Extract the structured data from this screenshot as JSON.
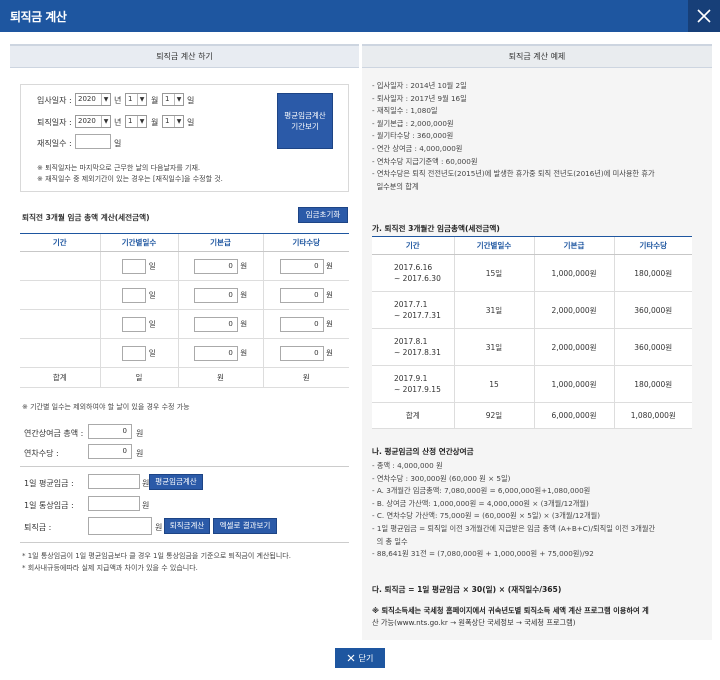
{
  "window": {
    "title": "퇴직금 계산"
  },
  "left": {
    "header": "퇴직금 계산 하기",
    "form": {
      "join_label": "입사일자 :",
      "leave_label": "퇴직일자 :",
      "workdays_label": "재직일수 :",
      "year_unit": "년",
      "month_unit": "월",
      "day_unit": "일",
      "join_year": "2020",
      "join_month": "1",
      "join_day": "1",
      "leave_year": "2020",
      "leave_month": "1",
      "leave_day": "1",
      "workdays_value": "",
      "period_button": "평균임금계산\n기간보기",
      "note1": "※ 퇴직일자는 마지막으로 근무한 날의 다음날자를 기재.",
      "note2": "※ 재직일수 중 제외기간이 있는 경우는 [재직일수]을 수정할 것."
    },
    "wage_section_title": "퇴직전 3개월 임금 총액 계산(세전금액)",
    "reset_button": "임금초기화",
    "wage_table": {
      "headers": [
        "기간",
        "기간별일수",
        "기본급",
        "기타수당"
      ],
      "rows": [
        {
          "days": "",
          "days_unit": "일",
          "basic": "0",
          "basic_unit": "원",
          "other": "0",
          "other_unit": "원"
        },
        {
          "days": "",
          "days_unit": "일",
          "basic": "0",
          "basic_unit": "원",
          "other": "0",
          "other_unit": "원"
        },
        {
          "days": "",
          "days_unit": "일",
          "basic": "0",
          "basic_unit": "원",
          "other": "0",
          "other_unit": "원"
        },
        {
          "days": "",
          "days_unit": "일",
          "basic": "0",
          "basic_unit": "원",
          "other": "0",
          "other_unit": "원"
        }
      ],
      "total_label": "합계",
      "total_days": "일",
      "total_basic": "원",
      "total_other": "원"
    },
    "days_note": "※ 기간별 일수는 제외하여야 할 날이 있을 경우 수정 가능",
    "bonus_label": "연간상여금 총액 :",
    "bonus_value": "0",
    "allowance_label": "연차수당 :",
    "allowance_value": "0",
    "won": "원",
    "avg_wage_label": "1일 평균임금 :",
    "avg_wage_button": "평균임금계산",
    "normal_wage_label": "1일 통상임금 :",
    "severance_label": "퇴직금 :",
    "severance_button": "퇴직금계산",
    "excel_button": "엑셀로 결과보기",
    "footnote1": "* 1일 통상임금이 1일 평균임금보다 클 경우 1일 통상임금을 기준으로 퇴직금이 계산됩니다.",
    "footnote2": "* 회사내규등에따라 실제 지급액과 차이가 있을 수 있습니다."
  },
  "right": {
    "header": "퇴직금 계산 예제",
    "info": [
      "- 입사일자 : 2014년 10월 2일",
      "- 퇴사일자 : 2017년 9월 16일",
      "- 재직일수 : 1,080일",
      "- 월기본급 : 2,000,000원",
      "- 월기타수당 : 360,000원",
      "- 연간 상여금 : 4,000,000원",
      "- 연차수당 지급기준액 : 60,000원",
      "- 연차수당은 퇴직 전전년도(2015년)에 발생한 휴가중 퇴직 전년도(2016년)에 미사용한 휴가",
      "  일수분의 합계"
    ],
    "section_a": "가. 퇴직전 3개월간 임금총액(세전금액)",
    "table": {
      "headers": [
        "기간",
        "기간별일수",
        "기본급",
        "기타수당"
      ],
      "rows": [
        {
          "period1": "2017.6.16",
          "period2": "~ 2017.6.30",
          "days": "15일",
          "basic": "1,000,000원",
          "other": "180,000원"
        },
        {
          "period1": "2017.7.1",
          "period2": "~ 2017.7.31",
          "days": "31일",
          "basic": "2,000,000원",
          "other": "360,000원"
        },
        {
          "period1": "2017.8.1",
          "period2": "~ 2017.8.31",
          "days": "31일",
          "basic": "2,000,000원",
          "other": "360,000원"
        },
        {
          "period1": "2017.9.1",
          "period2": "~ 2017.9.15",
          "days": "15",
          "basic": "1,000,000원",
          "other": "180,000원"
        }
      ],
      "total": {
        "label": "합계",
        "days": "92일",
        "basic": "6,000,000원",
        "other": "1,080,000원"
      }
    },
    "section_b": "나. 평균임금의 산정 연간상여금",
    "calc": [
      "- 종액 : 4,000,000 원",
      "- 연차수당 : 300,000원 (60,000 원 × 5일)",
      "- A. 3개월간 임금총액: 7,080,000원 = 6,000,000원+1,080,000원",
      "- B. 상여금 가산액: 1,000,000원 = 4,000,000원 × (3개월/12개월)",
      "- C. 연차수당 가산액: 75,000원 = (60,000원 × 5일) × (3개월/12개월)",
      "- 1일 평균임금 = 퇴직일 이전 3개월간에 지급받은 임금 총액 (A+B+C)/퇴직일 이전 3개월간",
      "  의 총 일수",
      "- 88,641원 31전 = (7,080,000원 + 1,000,000원 + 75,000원)/92"
    ],
    "section_c": "다. 퇴직금 = 1일 평균임금 × 30(일) × (재직일수/365)",
    "tax_note1": "※ 퇴직소득세는 국세청 홈페이지에서 귀속년도별 퇴직소득 세액 계산 프로그램 이용하여 계",
    "tax_note2": "산 가능(www.nts.go.kr → 원폭상단 국세정보 → 국세청 프로그램)"
  },
  "footer": {
    "close_button": "닫기"
  },
  "colors": {
    "brand": "#1e56a0",
    "button": "#2b5aa8"
  },
  "icons": {
    "close": "close-icon",
    "dropdown": "chevron-down-icon"
  }
}
